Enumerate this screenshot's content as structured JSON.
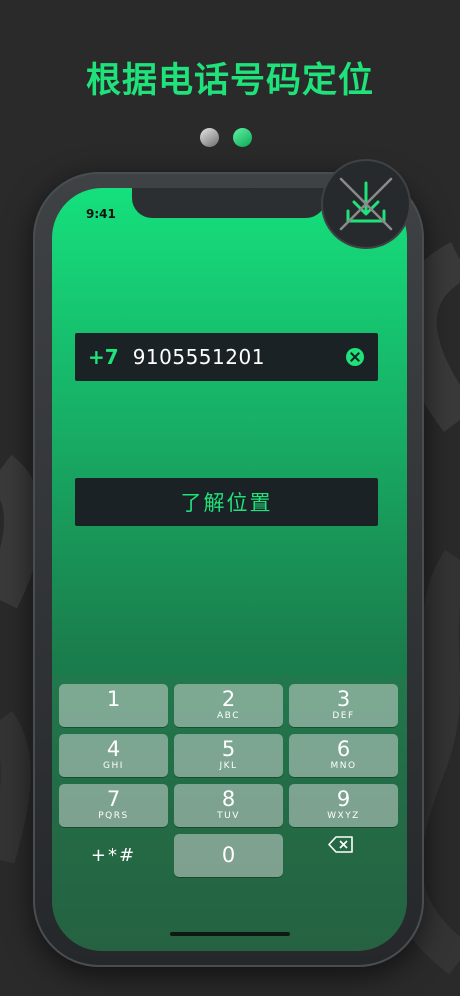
{
  "headline": "根据电话号码定位",
  "status_time": "9:41",
  "phone_input": {
    "country_code": "+7",
    "number": "9105551201"
  },
  "locate_button_label": "了解位置",
  "keypad": {
    "keys": [
      {
        "digit": "1",
        "letters": ""
      },
      {
        "digit": "2",
        "letters": "ABC"
      },
      {
        "digit": "3",
        "letters": "DEF"
      },
      {
        "digit": "4",
        "letters": "GHI"
      },
      {
        "digit": "5",
        "letters": "JKL"
      },
      {
        "digit": "6",
        "letters": "MNO"
      },
      {
        "digit": "7",
        "letters": "PQRS"
      },
      {
        "digit": "8",
        "letters": "TUV"
      },
      {
        "digit": "9",
        "letters": "WXYZ"
      }
    ],
    "symbols": "+*#",
    "zero": "0"
  },
  "colors": {
    "accent": "#1fe27a",
    "background": "#2a2a2a",
    "field": "#1a2226"
  },
  "icons": {
    "download": "download-icon",
    "clear": "clear-icon",
    "backspace": "backspace-icon"
  }
}
